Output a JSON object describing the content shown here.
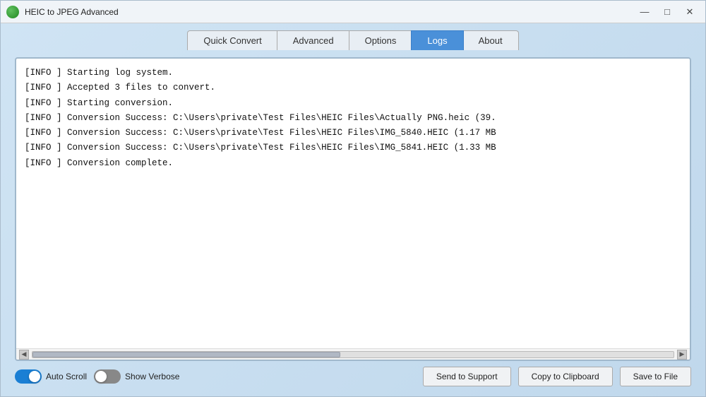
{
  "window": {
    "title": "HEIC to JPEG Advanced",
    "minimize_label": "—",
    "maximize_label": "□",
    "close_label": "✕"
  },
  "tabs": [
    {
      "id": "quick-convert",
      "label": "Quick Convert",
      "active": false
    },
    {
      "id": "advanced",
      "label": "Advanced",
      "active": false
    },
    {
      "id": "options",
      "label": "Options",
      "active": false
    },
    {
      "id": "logs",
      "label": "Logs",
      "active": true
    },
    {
      "id": "about",
      "label": "About",
      "active": false
    }
  ],
  "log": {
    "lines": [
      "[INFO    ] Starting log system.",
      "[INFO    ] Accepted 3 files to convert.",
      "[INFO    ] Starting conversion.",
      "[INFO    ] Conversion Success: C:\\Users\\private\\Test Files\\HEIC Files\\Actually PNG.heic (39.",
      "[INFO    ] Conversion Success: C:\\Users\\private\\Test Files\\HEIC Files\\IMG_5840.HEIC (1.17 MB",
      "[INFO    ] Conversion Success: C:\\Users\\private\\Test Files\\HEIC Files\\IMG_5841.HEIC (1.33 MB",
      "[INFO    ] Conversion complete."
    ]
  },
  "controls": {
    "auto_scroll_label": "Auto Scroll",
    "show_verbose_label": "Show Verbose",
    "auto_scroll_on": true,
    "show_verbose_on": false
  },
  "buttons": {
    "send_to_support": "Send to Support",
    "copy_to_clipboard": "Copy to Clipboard",
    "save_to_file": "Save to File"
  }
}
